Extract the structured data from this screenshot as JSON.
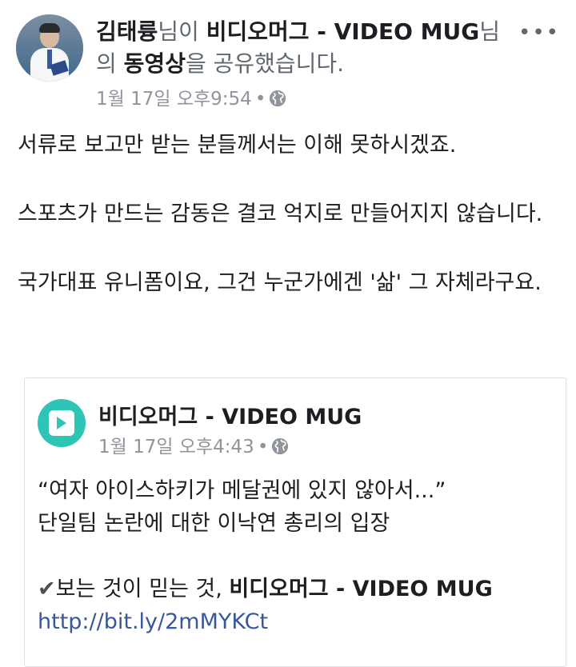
{
  "post": {
    "author": "김태륭",
    "verb1": "님이 ",
    "page": "비디오머그 - VIDEO MUG",
    "verb2": "님의 ",
    "object": "동영상",
    "verb3": "을 공유했습니다.",
    "timestamp": "1월 17일 오후9:54",
    "dot": "•",
    "privacy_icon": "globe-icon",
    "more_icon": "more-icon",
    "more_label": "•••",
    "paragraphs": [
      "서류로 보고만 받는 분들께서는 이해 못하시겠죠.",
      "스포츠가 만드는 감동은 결코 억지로 만들어지지 않습니다.",
      "국가대표 유니폼이요, 그건 누군가에겐 '삶' 그 자체라구요."
    ]
  },
  "shared": {
    "name": "비디오머그 - VIDEO MUG",
    "timestamp": "1월 17일 오후4:43",
    "dot": "•",
    "privacy_icon": "globe-icon",
    "line1": "“여자 아이스하키가 메달권에 있지 않아서...”",
    "line2": "단일팀 논란에 대한 이낙연 총리의 입장",
    "check": "✔",
    "tagline": "보는 것이 믿는 것, ",
    "tagline_bold": "비디오머그 - VIDEO MUG",
    "link": "http://bit.ly/2mMYKCt"
  },
  "colors": {
    "text": "#1c1e21",
    "secondary": "#90949c",
    "link": "#385898",
    "brand": "#2ec4b6"
  }
}
